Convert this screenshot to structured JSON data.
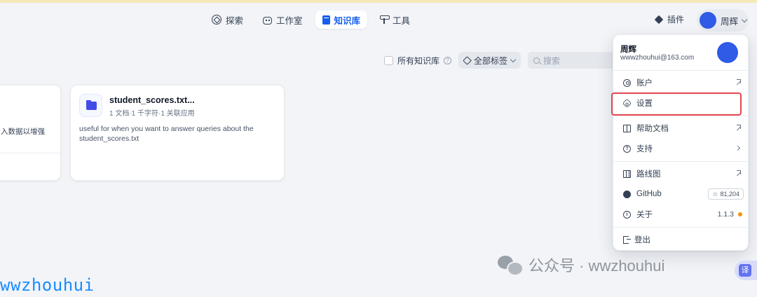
{
  "nav": {
    "explore": "探索",
    "studio": "工作室",
    "knowledge": "知识库",
    "tools": "工具"
  },
  "header": {
    "plugins": "插件",
    "user_name": "周辉"
  },
  "filters": {
    "all_kb_label": "所有知识库",
    "help_glyph": "?",
    "tags_label": "全部标签",
    "search_placeholder": "搜索"
  },
  "cards": {
    "left_snippet": "入数据以增强",
    "main": {
      "title": "student_scores.txt...",
      "meta": "1 文档·1 千字符·1 关联应用",
      "description": "useful for when you want to answer queries about the student_scores.txt"
    }
  },
  "menu": {
    "name": "周辉",
    "email": "wwwzhouhui@163.com",
    "items": {
      "account": "账户",
      "settings": "设置",
      "help_docs": "帮助文档",
      "support": "支持",
      "roadmap": "路线图",
      "github": "GitHub",
      "github_stars": "81,204",
      "about": "关于",
      "version": "1.1.3",
      "logout": "登出"
    }
  },
  "watermark": {
    "text": "公众号 · wwzhouhui",
    "corner": "wwzhouhui",
    "translate": "译"
  },
  "colors": {
    "accent": "#155eef",
    "highlight": "#e5484d",
    "avatar": "#2f5be6",
    "status_dot": "#f79009"
  }
}
